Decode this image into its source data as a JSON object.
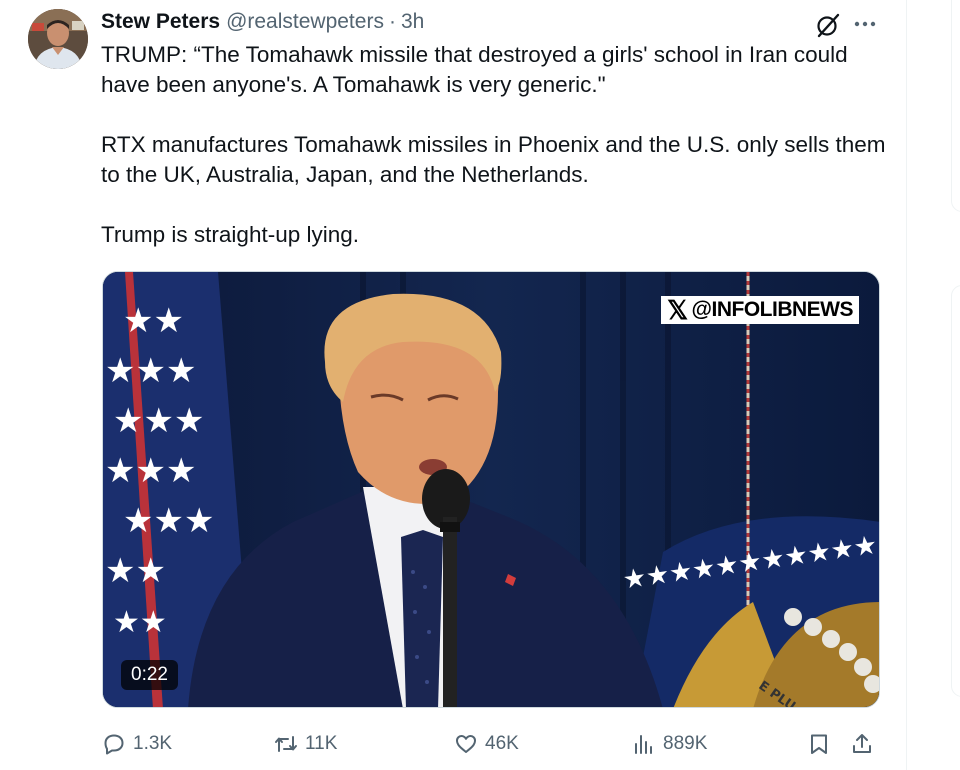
{
  "tweet": {
    "display_name": "Stew Peters",
    "handle": "@realstewpeters",
    "separator": "·",
    "time": "3h",
    "paragraphs": [
      "TRUMP: “The Tomahawk missile that destroyed a girls' school in Iran could have been anyone's. A Tomahawk is very generic.\"",
      "RTX manufactures Tomahawk missiles in Phoenix and the U.S. only sells them to the UK, Australia, Japan, and the Netherlands.",
      "Trump is straight-up lying."
    ]
  },
  "media": {
    "watermark": "@INFOLIBNEWS",
    "watermark_logo": "𝕏",
    "duration": "0:22"
  },
  "actions": {
    "replies": "1.3K",
    "retweets": "11K",
    "likes": "46K",
    "views": "889K"
  },
  "icons": {
    "grok": "grok-icon",
    "more": "more-icon",
    "reply": "reply-icon",
    "retweet": "retweet-icon",
    "like": "heart-icon",
    "views": "views-icon",
    "bookmark": "bookmark-icon",
    "share": "share-icon"
  },
  "colors": {
    "text": "#0f1419",
    "secondary": "#536471",
    "border": "#eff3f4"
  }
}
